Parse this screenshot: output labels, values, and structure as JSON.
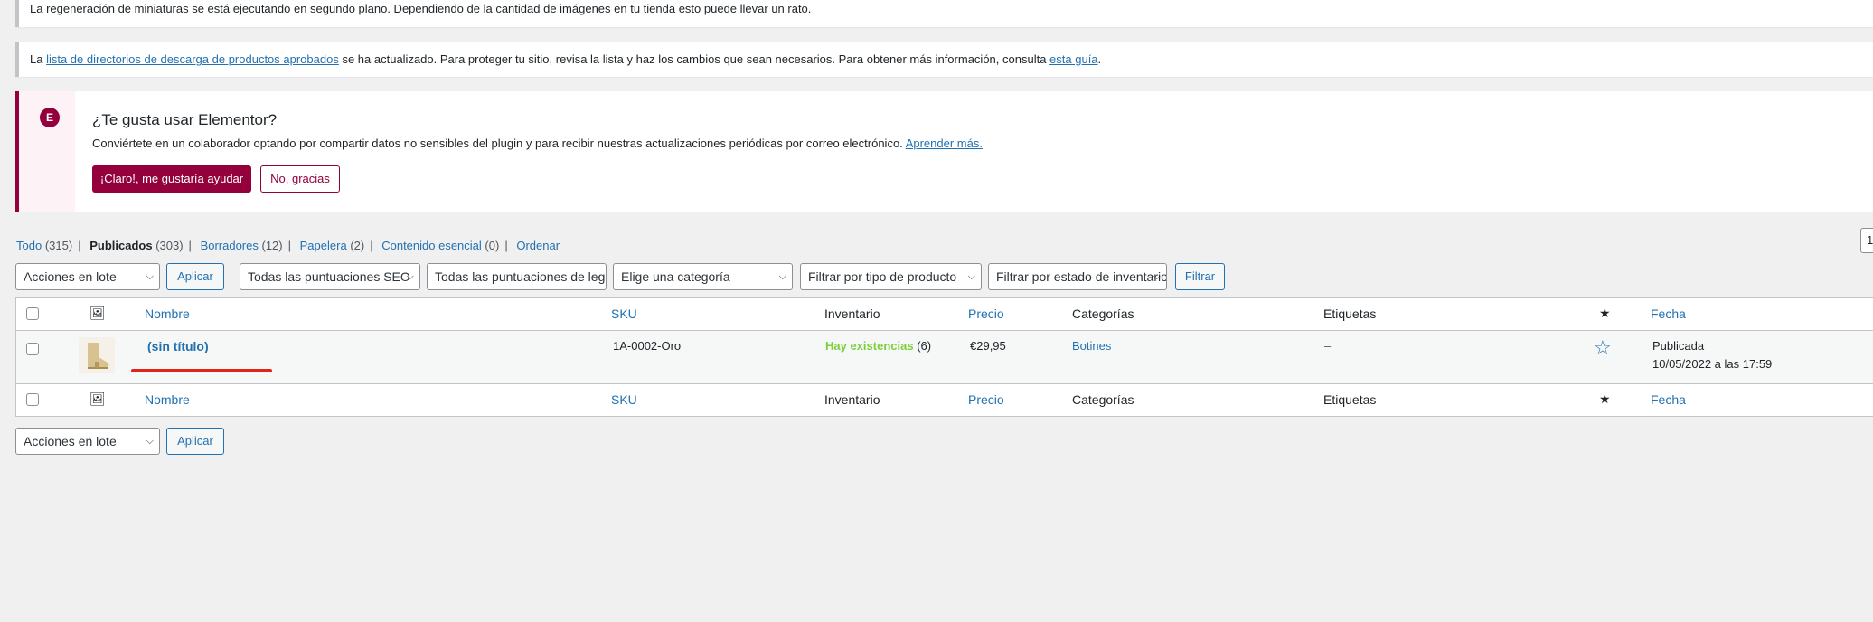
{
  "notices": {
    "regen": "La regeneración de miniaturas se está ejecutando en segundo plano. Dependiendo de la cantidad de imágenes en tu tienda esto puede llevar un rato.",
    "downloads": {
      "prefix": "La ",
      "link": "lista de directorios de descarga de productos aprobados",
      "middle": " se ha actualizado. Para proteger tu sitio, revisa la lista y haz los cambios que sean necesarios. Para obtener más información, consulta ",
      "guide_link": "esta guía",
      "suffix": "."
    }
  },
  "elementor": {
    "logo": "E",
    "title": "¿Te gusta usar Elementor?",
    "description": "Conviértete en un colaborador optando por compartir datos no sensibles del plugin y para recibir nuestras actualizaciones periódicas por correo electrónico. ",
    "learn_more": "Aprender más.",
    "accept_button": "¡Claro!, me gustaría ayudar",
    "decline_button": "No, gracias",
    "brand_color": "#93003c"
  },
  "views": [
    {
      "label": "Todo",
      "count": "(315)"
    },
    {
      "label": "Publicados",
      "count": "(303)"
    },
    {
      "label": "Borradores",
      "count": "(12)"
    },
    {
      "label": "Papelera",
      "count": "(2)"
    },
    {
      "label": "Contenido esencial",
      "count": "(0)"
    },
    {
      "label": "Ordenar",
      "count": ""
    }
  ],
  "filters": {
    "bulk_actions": "Acciones en lote",
    "apply": "Aplicar",
    "ratings_1": "Todas las puntuaciones SEO",
    "ratings_2": "Todas las puntuaciones de legibilidad",
    "category": "Elige una categoría",
    "product_type": "Filtrar por tipo de producto",
    "stock_status": "Filtrar por estado de inventario",
    "filter_button": "Filtrar",
    "page_number": "1"
  },
  "table": {
    "columns": {
      "name": "Nombre",
      "sku": "SKU",
      "stock": "Inventario",
      "price": "Precio",
      "categories": "Categorías",
      "tags": "Etiquetas",
      "date": "Fecha"
    },
    "rows": [
      {
        "name": "(sin título)",
        "sku": "1A-0002-Oro",
        "stock_label": "Hay existencias",
        "stock_count": "(6)",
        "price": "€29,95",
        "category": "Botines",
        "tags": "–",
        "status": "Publicada",
        "date": "10/05/2022 a las 17:59"
      }
    ]
  },
  "bottom": {
    "bulk_actions": "Acciones en lote",
    "apply": "Aplicar"
  }
}
